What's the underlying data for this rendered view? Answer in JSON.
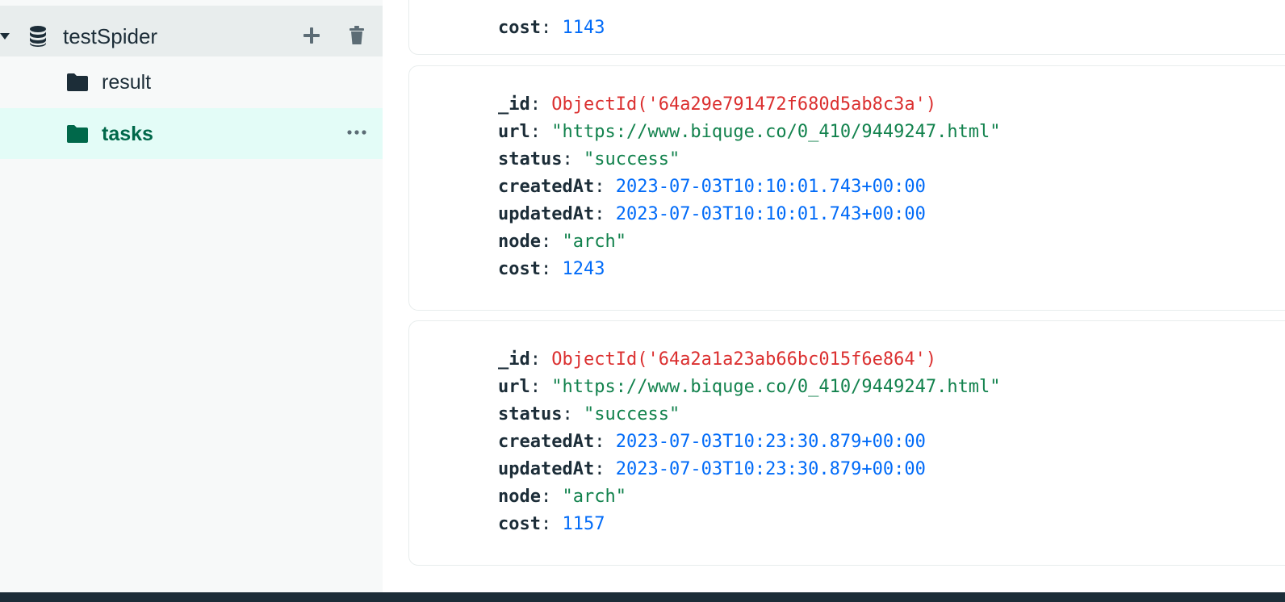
{
  "sidebar": {
    "database": {
      "label": "testSpider",
      "add_icon": "plus-icon",
      "delete_icon": "trash-icon",
      "db_icon": "database-icon"
    },
    "collections": [
      {
        "label": "result",
        "icon": "folder-icon"
      },
      {
        "label": "tasks",
        "icon": "folder-icon",
        "selected": true,
        "menu_icon": "ellipsis-icon"
      }
    ]
  },
  "documents": [
    {
      "fields": [
        {
          "key": "cost",
          "value": "1143"
        }
      ]
    },
    {
      "fields": [
        {
          "key": "_id",
          "value": "ObjectId('64a29e791472f680d5ab8c3a')"
        },
        {
          "key": "url",
          "value": "\"https://www.biquge.co/0_410/9449247.html\""
        },
        {
          "key": "status",
          "value": "\"success\""
        },
        {
          "key": "createdAt",
          "value": "2023-07-03T10:10:01.743+00:00"
        },
        {
          "key": "updatedAt",
          "value": "2023-07-03T10:10:01.743+00:00"
        },
        {
          "key": "node",
          "value": "\"arch\""
        },
        {
          "key": "cost",
          "value": "1243"
        }
      ]
    },
    {
      "fields": [
        {
          "key": "_id",
          "value": "ObjectId('64a2a1a23ab66bc015f6e864')"
        },
        {
          "key": "url",
          "value": "\"https://www.biquge.co/0_410/9449247.html\""
        },
        {
          "key": "status",
          "value": "\"success\""
        },
        {
          "key": "createdAt",
          "value": "2023-07-03T10:23:30.879+00:00"
        },
        {
          "key": "updatedAt",
          "value": "2023-07-03T10:23:30.879+00:00"
        },
        {
          "key": "node",
          "value": "\"arch\""
        },
        {
          "key": "cost",
          "value": "1157"
        }
      ]
    }
  ],
  "colors": {
    "accent": "#00684a",
    "selected_bg": "#e3fcf7",
    "string": "#12824d",
    "number": "#016bf8",
    "objectid": "#db3030",
    "text": "#1c2d38"
  }
}
